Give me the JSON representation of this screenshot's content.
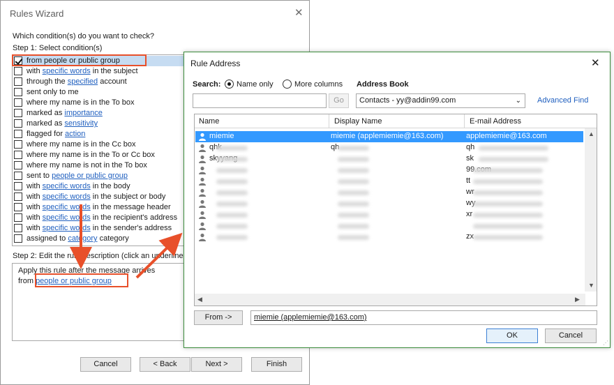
{
  "rules_wizard": {
    "title": "Rules Wizard",
    "question": "Which condition(s) do you want to check?",
    "step1": "Step 1: Select condition(s)",
    "conditions": [
      {
        "pre": "from people or public group",
        "link": "",
        "post": "",
        "checked": true
      },
      {
        "pre": "with ",
        "link": "specific words",
        "post": " in the subject",
        "checked": false
      },
      {
        "pre": "through the ",
        "link": "specified",
        "post": " account",
        "checked": false
      },
      {
        "pre": "sent only to me",
        "link": "",
        "post": "",
        "checked": false
      },
      {
        "pre": "where my name is in the To box",
        "link": "",
        "post": "",
        "checked": false
      },
      {
        "pre": "marked as ",
        "link": "importance",
        "post": "",
        "checked": false
      },
      {
        "pre": "marked as ",
        "link": "sensitivity",
        "post": "",
        "checked": false
      },
      {
        "pre": "flagged for ",
        "link": "action",
        "post": "",
        "checked": false
      },
      {
        "pre": "where my name is in the Cc box",
        "link": "",
        "post": "",
        "checked": false
      },
      {
        "pre": "where my name is in the To or Cc box",
        "link": "",
        "post": "",
        "checked": false
      },
      {
        "pre": "where my name is not in the To box",
        "link": "",
        "post": "",
        "checked": false
      },
      {
        "pre": "sent to ",
        "link": "people or public group",
        "post": "",
        "checked": false
      },
      {
        "pre": "with ",
        "link": "specific words",
        "post": " in the body",
        "checked": false
      },
      {
        "pre": "with ",
        "link": "specific words",
        "post": " in the subject or body",
        "checked": false
      },
      {
        "pre": "with ",
        "link": "specific words",
        "post": " in the message header",
        "checked": false
      },
      {
        "pre": "with ",
        "link": "specific words",
        "post": " in the recipient's address",
        "checked": false
      },
      {
        "pre": "with ",
        "link": "specific words",
        "post": " in the sender's address",
        "checked": false
      },
      {
        "pre": "assigned to ",
        "link": "category",
        "post": " category",
        "checked": false
      }
    ],
    "step2": "Step 2: Edit the rule description (click an underlined value)",
    "desc_line1": "Apply this rule after the message arrives",
    "desc_from": "from ",
    "desc_link": "people or public group",
    "buttons": {
      "cancel": "Cancel",
      "back": "< Back",
      "next": "Next >",
      "finish": "Finish"
    }
  },
  "rule_address": {
    "title": "Rule Address",
    "search_label": "Search:",
    "radio_name_only": "Name only",
    "radio_more_columns": "More columns",
    "address_book_label": "Address Book",
    "search_value": "",
    "go_label": "Go",
    "address_book_value": "Contacts - yy@addin99.com",
    "advanced_find": "Advanced Find",
    "columns": [
      "Name",
      "Display Name",
      "E-mail Address"
    ],
    "rows": [
      {
        "name": "miemie",
        "display": "miemie (applemiemie@163.com)",
        "email": "applemiemie@163.com"
      },
      {
        "name": "qhk",
        "display": "qh",
        "email": "qh"
      },
      {
        "name": "skyyang",
        "display": "",
        "email": "sk"
      },
      {
        "name": "",
        "display": "",
        "email": "99.com"
      },
      {
        "name": "",
        "display": "",
        "email": "tt"
      },
      {
        "name": "",
        "display": "",
        "email": "wr"
      },
      {
        "name": "",
        "display": "",
        "email": "wy"
      },
      {
        "name": "",
        "display": "",
        "email": "xr"
      },
      {
        "name": "",
        "display": "",
        "email": ""
      },
      {
        "name": "",
        "display": "",
        "email": "zx"
      }
    ],
    "from_button": "From ->",
    "from_value": "miemie (applemiemie@163.com)",
    "ok": "OK",
    "cancel": "Cancel"
  },
  "colors": {
    "accent": "#3399ff",
    "highlight": "#e8502a",
    "link": "#1f5fbf",
    "dialog_border": "#3c8c3c"
  }
}
